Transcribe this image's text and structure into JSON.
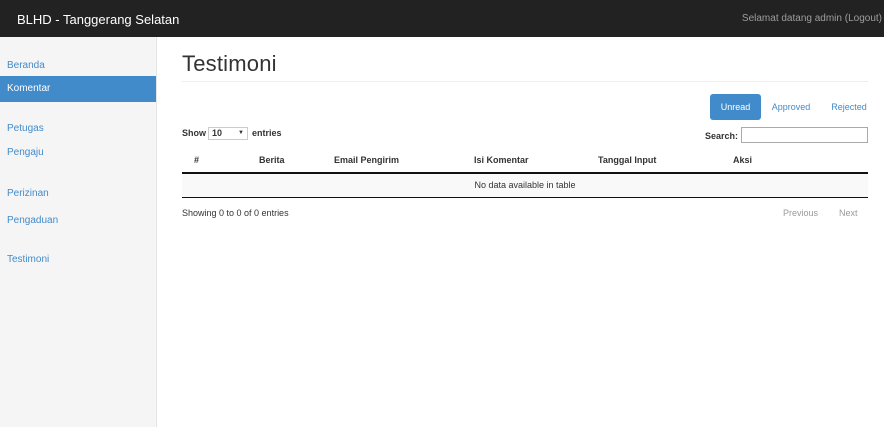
{
  "navbar": {
    "brand": "BLHD - Tanggerang Selatan",
    "welcome": "Selamat datang admin (Logout)"
  },
  "sidebar": {
    "items": [
      {
        "label": "Beranda",
        "active": false
      },
      {
        "label": "Komentar",
        "active": true
      },
      {
        "label": "Petugas",
        "active": false
      },
      {
        "label": "Pengaju",
        "active": false
      },
      {
        "label": "Perizinan",
        "active": false
      },
      {
        "label": "Pengaduan",
        "active": false
      },
      {
        "label": "Testimoni",
        "active": false
      }
    ]
  },
  "main": {
    "title": "Testimoni",
    "tabs": [
      {
        "label": "Unread",
        "active": true
      },
      {
        "label": "Approved",
        "active": false
      },
      {
        "label": "Rejected",
        "active": false
      }
    ],
    "length": {
      "prefix": "Show",
      "value": "10",
      "suffix": "entries"
    },
    "search": {
      "label": "Search:",
      "value": ""
    },
    "table": {
      "columns": [
        "#",
        "Berita",
        "Email Pengirim",
        "Isi Komentar",
        "Tanggal Input",
        "Aksi"
      ],
      "empty_message": "No data available in table"
    },
    "info": "Showing 0 to 0 of 0 entries",
    "pager": {
      "previous": "Previous",
      "next": "Next"
    }
  },
  "colors": {
    "navbar": "#222222",
    "accent": "#428bca",
    "sidebar_bg": "#f5f5f5"
  }
}
